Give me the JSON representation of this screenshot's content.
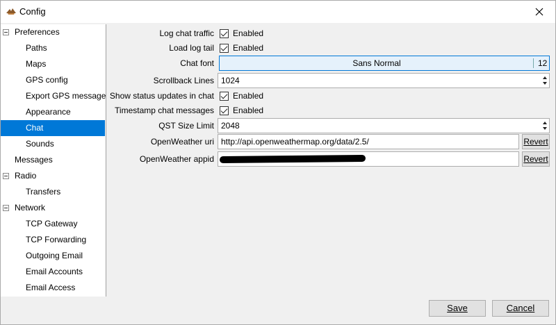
{
  "window": {
    "title": "Config",
    "close_glyph": "✕"
  },
  "sidebar": {
    "items": [
      {
        "label": "Preferences",
        "level": 0,
        "expander": true,
        "selected": false
      },
      {
        "label": "Paths",
        "level": 1,
        "selected": false
      },
      {
        "label": "Maps",
        "level": 1,
        "selected": false
      },
      {
        "label": "GPS config",
        "level": 1,
        "selected": false
      },
      {
        "label": "Export GPS messages",
        "level": 1,
        "selected": false
      },
      {
        "label": "Appearance",
        "level": 1,
        "selected": false
      },
      {
        "label": "Chat",
        "level": 1,
        "selected": true
      },
      {
        "label": "Sounds",
        "level": 1,
        "selected": false
      },
      {
        "label": "Messages",
        "level": 0,
        "expander": false,
        "selected": false
      },
      {
        "label": "Radio",
        "level": 0,
        "expander": true,
        "selected": false
      },
      {
        "label": "Transfers",
        "level": 1,
        "selected": false
      },
      {
        "label": "Network",
        "level": 0,
        "expander": true,
        "selected": false
      },
      {
        "label": "TCP Gateway",
        "level": 1,
        "selected": false
      },
      {
        "label": "TCP Forwarding",
        "level": 1,
        "selected": false
      },
      {
        "label": "Outgoing Email",
        "level": 1,
        "selected": false
      },
      {
        "label": "Email Accounts",
        "level": 1,
        "selected": false
      },
      {
        "label": "Email Access",
        "level": 1,
        "selected": false
      }
    ]
  },
  "settings": {
    "log_chat_traffic": {
      "label": "Log chat traffic",
      "value": "Enabled"
    },
    "load_log_tail": {
      "label": "Load log tail",
      "value": "Enabled"
    },
    "chat_font": {
      "label": "Chat font",
      "name": "Sans Normal",
      "size": "12"
    },
    "scrollback_lines": {
      "label": "Scrollback Lines",
      "value": "1024"
    },
    "show_status_updates": {
      "label": "Show status updates in chat",
      "value": "Enabled"
    },
    "timestamp_chat": {
      "label": "Timestamp chat messages",
      "value": "Enabled"
    },
    "qst_size_limit": {
      "label": "QST Size Limit",
      "value": "2048"
    },
    "openweather_uri": {
      "label": "OpenWeather uri",
      "value": "http://api.openweathermap.org/data/2.5/",
      "revert": "Revert"
    },
    "openweather_appid": {
      "label": "OpenWeather appid",
      "revert": "Revert"
    }
  },
  "buttons": {
    "save": "Save",
    "cancel": "Cancel"
  },
  "colors": {
    "selection": "#0078d7",
    "font_button_bg": "#e5f1fb"
  }
}
